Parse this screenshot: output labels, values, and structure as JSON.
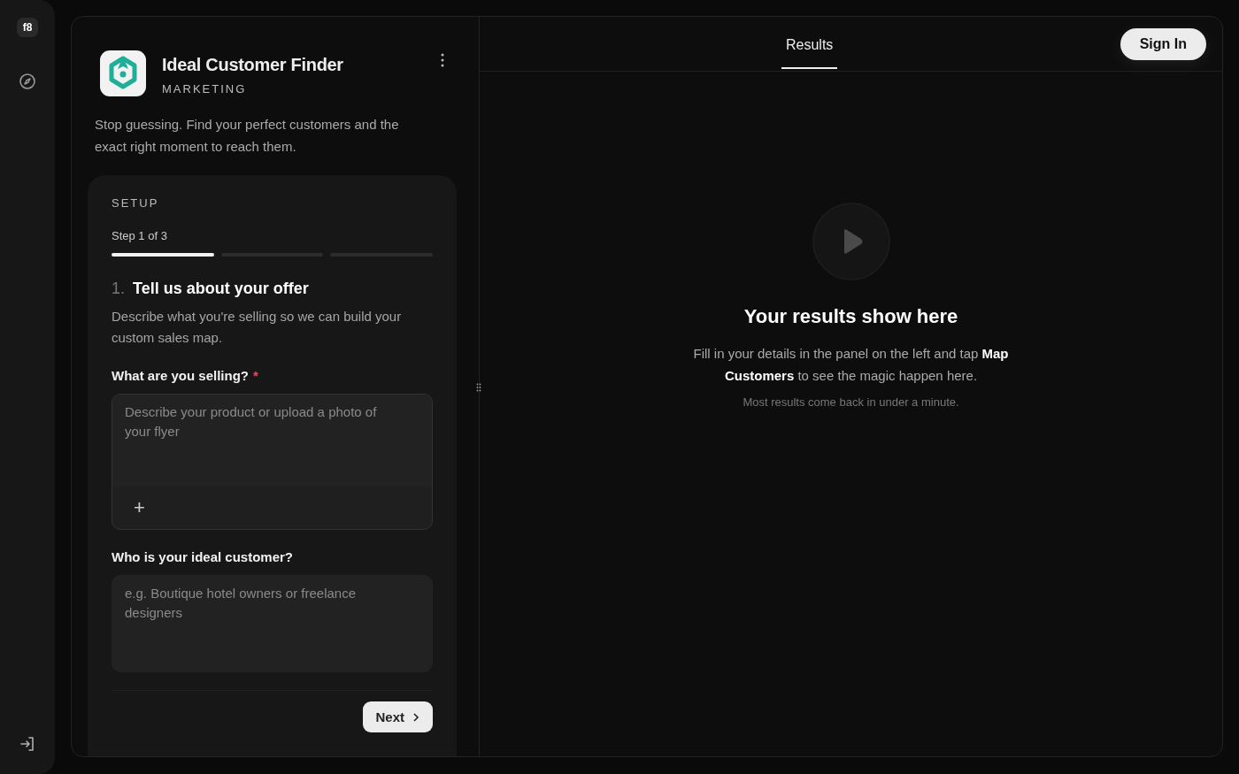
{
  "rail": {
    "logo": "f8"
  },
  "app": {
    "name": "Ideal Customer Finder",
    "category": "MARKETING",
    "description": "Stop guessing. Find your perfect customers and the exact right moment to reach them."
  },
  "setup": {
    "heading": "SETUP",
    "step": "Step 1 of 3",
    "segments": [
      {
        "level": 1
      },
      {
        "level": 0
      },
      {
        "level": 0
      }
    ],
    "number": "1.",
    "title": "Tell us about your offer",
    "subtitle": "Describe what you're selling so we can build your custom sales map.",
    "fields": [
      {
        "label": "What are you selling?",
        "required": true,
        "placeholder": "Describe your product or upload a photo of your flyer",
        "attach": "+"
      },
      {
        "label": "Who is your ideal customer?",
        "required": false,
        "placeholder": "e.g. Boutique hotel owners or freelance designers"
      }
    ],
    "required_mark": "*",
    "next": "Next"
  },
  "tabs": [
    {
      "label": "Results",
      "selected": true
    }
  ],
  "sign_in": "Sign In",
  "empty": {
    "title": "Your results show here",
    "text": "Fill in your details in the panel on the left and tap **Map Customers** to see the magic happen here.",
    "note": "Most results come back in under a minute."
  }
}
